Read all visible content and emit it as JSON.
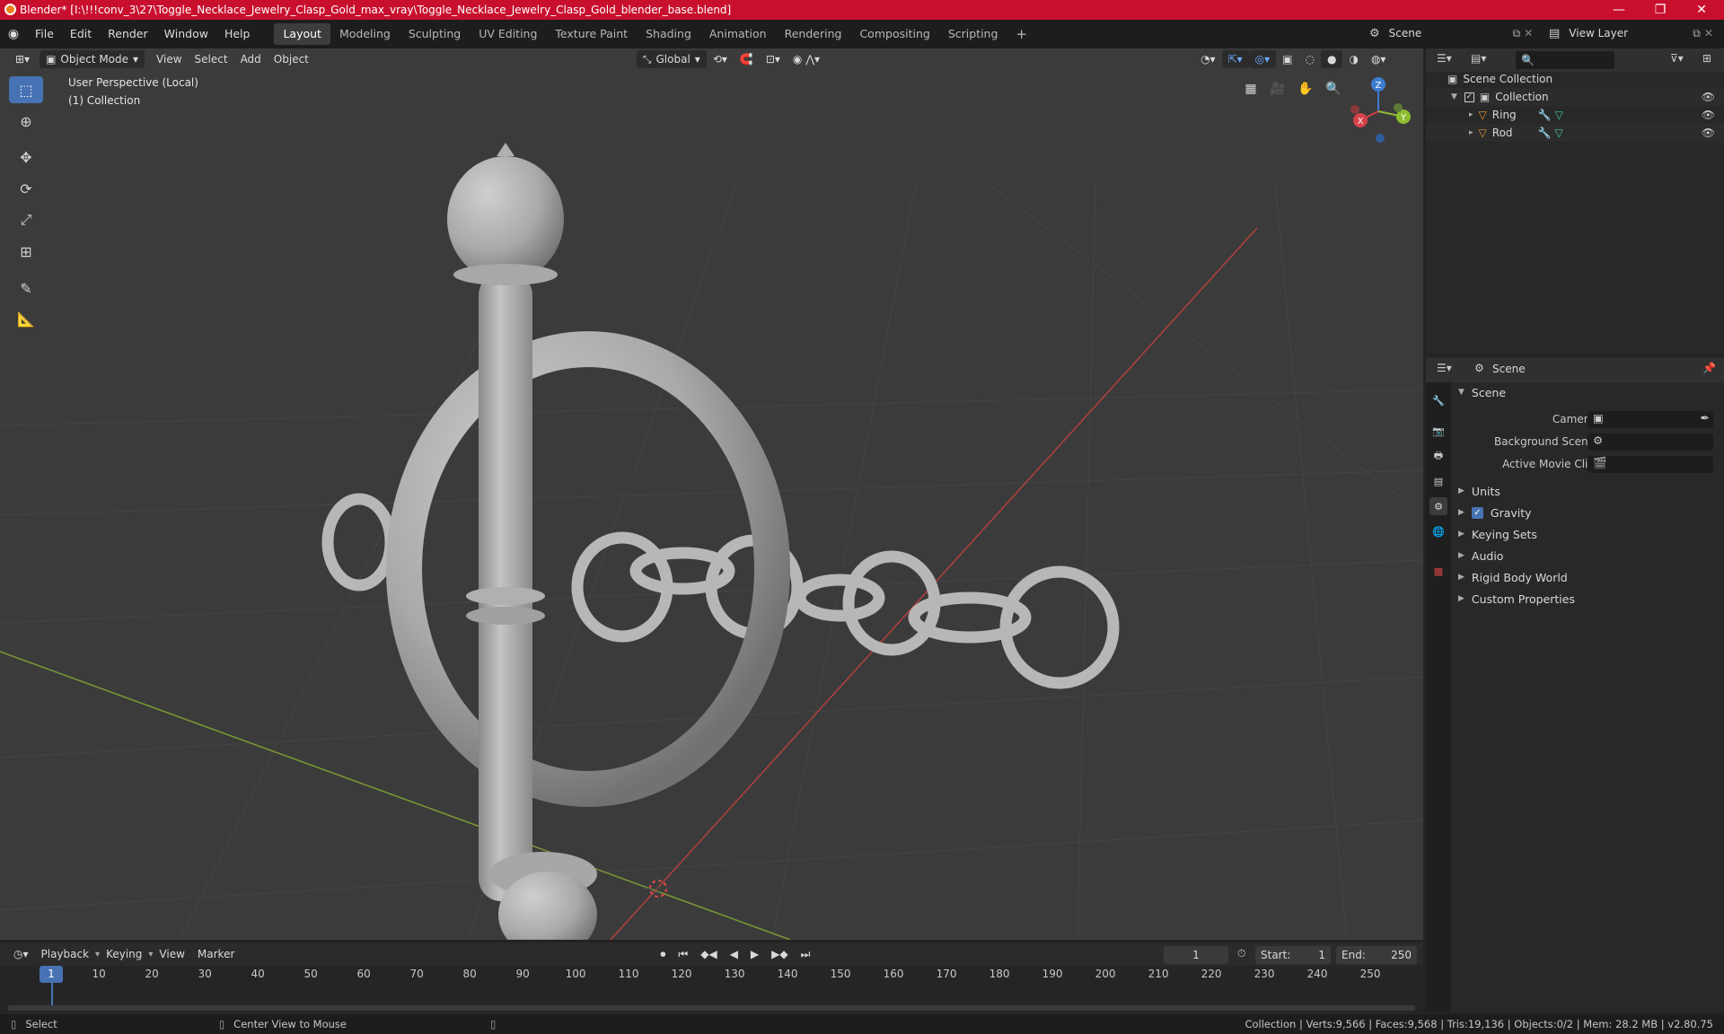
{
  "window": {
    "title": "Blender* [I:\\!!!conv_3\\27\\Toggle_Necklace_Jewelry_Clasp_Gold_max_vray\\Toggle_Necklace_Jewelry_Clasp_Gold_blender_base.blend]",
    "controls": {
      "minimize": "—",
      "maximize": "❐",
      "close": "✕"
    }
  },
  "menu": {
    "items": [
      "File",
      "Edit",
      "Render",
      "Window",
      "Help"
    ],
    "workspaces": [
      "Layout",
      "Modeling",
      "Sculpting",
      "UV Editing",
      "Texture Paint",
      "Shading",
      "Animation",
      "Rendering",
      "Compositing",
      "Scripting"
    ],
    "active_workspace": "Layout",
    "add_tab": "+",
    "scene_name": "Scene",
    "view_layer": "View Layer"
  },
  "viewport_header": {
    "mode": "Object Mode",
    "menus": [
      "View",
      "Select",
      "Add",
      "Object"
    ],
    "orientation": "Global"
  },
  "viewport": {
    "perspective_label": "User Perspective (Local)",
    "collection_label": "(1) Collection",
    "gizmo": {
      "z": "Z",
      "y": "Y",
      "x": "X"
    }
  },
  "outliner": {
    "root": "Scene Collection",
    "collection": "Collection",
    "objects": [
      "Ring",
      "Rod"
    ]
  },
  "properties": {
    "header_title": "Scene",
    "panel_title": "Scene",
    "fields": {
      "camera": "Camera",
      "background_scene": "Background Scene",
      "active_movie_clip": "Active Movie Clip"
    },
    "sections": [
      "Units",
      "Gravity",
      "Keying Sets",
      "Audio",
      "Rigid Body World",
      "Custom Properties"
    ],
    "gravity_checked": true
  },
  "timeline": {
    "menus": [
      "Playback",
      "Keying",
      "View",
      "Marker"
    ],
    "current_frame": "1",
    "start_label": "Start:",
    "start": "1",
    "end_label": "End:",
    "end": "250",
    "ticks": [
      "10",
      "20",
      "30",
      "40",
      "50",
      "60",
      "70",
      "80",
      "90",
      "100",
      "110",
      "120",
      "130",
      "140",
      "150",
      "160",
      "170",
      "180",
      "190",
      "200",
      "210",
      "220",
      "230",
      "240",
      "250"
    ],
    "indicator": "1"
  },
  "status": {
    "select": "Select",
    "center": "Center View to Mouse",
    "stats": "Collection | Verts:9,566 | Faces:9,568 | Tris:19,136 | Objects:0/2 | Mem: 28.2 MB | v2.80.75"
  },
  "colors": {
    "accent": "#4772b3",
    "titlebar": "#c8102e",
    "x_axis": "#d5424a",
    "y_axis": "#8cbd2f",
    "z_axis": "#3d7cd1"
  }
}
